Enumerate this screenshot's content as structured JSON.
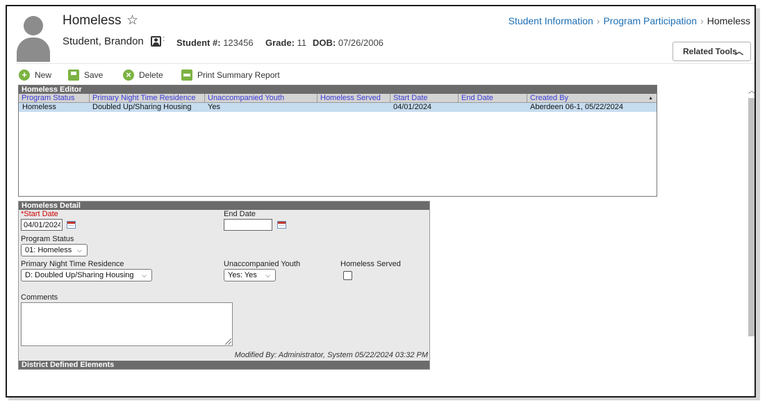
{
  "header": {
    "title": "Homeless",
    "student_name": "Student, Brandon",
    "student_num_label": "Student #:",
    "student_num": "123456",
    "grade_label": "Grade:",
    "grade": "11",
    "dob_label": "DOB:",
    "dob": "07/26/2006",
    "related_tools": "Related Tools"
  },
  "breadcrumb": [
    "Student Information",
    "Program Participation",
    "Homeless"
  ],
  "toolbar": {
    "new": "New",
    "save": "Save",
    "delete": "Delete",
    "print": "Print Summary Report"
  },
  "editor": {
    "title": "Homeless Editor",
    "columns": [
      "Program Status",
      "Primary Night Time Residence",
      "Unaccompanied Youth",
      "Homeless Served",
      "Start Date",
      "End Date",
      "Created By"
    ],
    "rows": [
      [
        "Homeless",
        "Doubled Up/Sharing Housing",
        "Yes",
        "",
        "04/01/2024",
        "",
        "Aberdeen 06-1, 05/22/2024"
      ]
    ]
  },
  "detail": {
    "title": "Homeless Detail",
    "start_date_label": "*Start Date",
    "start_date": "04/01/2024",
    "end_date_label": "End Date",
    "end_date": "",
    "program_status_label": "Program Status",
    "program_status": "01: Homeless",
    "residence_label": "Primary Night Time Residence",
    "residence": "D: Doubled Up/Sharing Housing",
    "unaccompanied_label": "Unaccompanied Youth",
    "unaccompanied": "Yes: Yes",
    "served_label": "Homeless Served",
    "served_checked": false,
    "comments_label": "Comments",
    "comments": "",
    "modified_by": "Modified By: Administrator, System 05/22/2024 03:32 PM",
    "district_section": "District Defined Elements"
  },
  "colors": {
    "accent": "#1d6fb5",
    "toolbar_icon": "#7cb342",
    "section_header": "#6b6b6b",
    "row_selected": "#c6dcef",
    "required": "#cc0000"
  },
  "icons": [
    "star-icon",
    "contact-card-icon",
    "plus-circle-icon",
    "save-icon",
    "x-circle-icon",
    "print-icon",
    "calendar-icon",
    "chevron-down-icon",
    "sort-arrow-icon",
    "resize-grip-icon"
  ]
}
